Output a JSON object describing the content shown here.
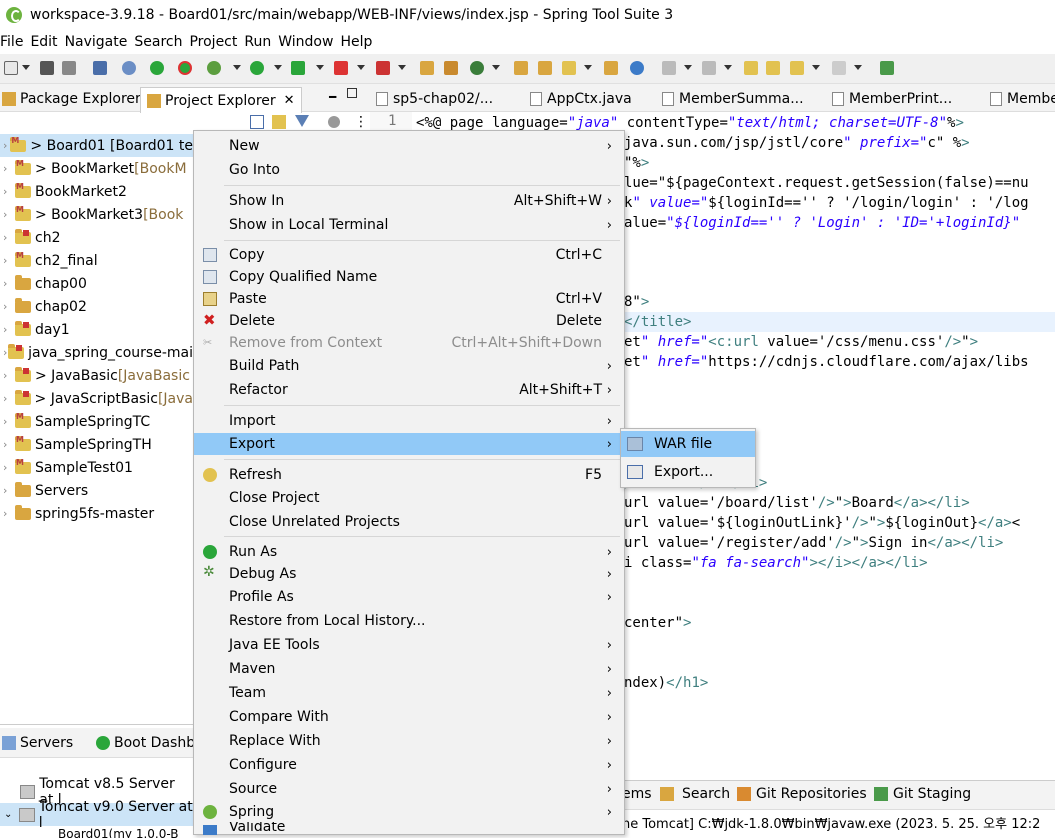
{
  "window": {
    "title": "workspace-3.9.18 - Board01/src/main/webapp/WEB-INF/views/index.jsp - Spring Tool Suite 3"
  },
  "menubar": [
    "File",
    "Edit",
    "Navigate",
    "Search",
    "Project",
    "Run",
    "Window",
    "Help"
  ],
  "left_tabs": {
    "package_explorer": "Package Explorer",
    "project_explorer": "Project Explorer"
  },
  "tree": [
    {
      "label": "> Board01 [Board01 te",
      "deco": "",
      "type": "maven",
      "expand": true,
      "selected": true
    },
    {
      "label": "> BookMarket ",
      "deco": "[BookM",
      "type": "maven",
      "expand": true
    },
    {
      "label": "BookMarket2",
      "deco": "",
      "type": "maven",
      "expand": true
    },
    {
      "label": "> BookMarket3 ",
      "deco": "[Book",
      "type": "maven",
      "expand": true
    },
    {
      "label": "ch2",
      "deco": "",
      "type": "java",
      "expand": true
    },
    {
      "label": "ch2_final",
      "deco": "",
      "type": "maven",
      "expand": true
    },
    {
      "label": "chap00",
      "deco": "",
      "type": "folder",
      "expand": true
    },
    {
      "label": "chap02",
      "deco": "",
      "type": "folder",
      "expand": true
    },
    {
      "label": "day1",
      "deco": "",
      "type": "java",
      "expand": true
    },
    {
      "label": "java_spring_course-mai",
      "deco": "",
      "type": "java",
      "expand": true
    },
    {
      "label": "> JavaBasic ",
      "deco": "[JavaBasic",
      "type": "java",
      "expand": true
    },
    {
      "label": "> JavaScriptBasic ",
      "deco": "[Java",
      "type": "java",
      "expand": true
    },
    {
      "label": "SampleSpringTC",
      "deco": "",
      "type": "maven",
      "expand": true
    },
    {
      "label": "SampleSpringTH",
      "deco": "",
      "type": "maven",
      "expand": true
    },
    {
      "label": "SampleTest01",
      "deco": "",
      "type": "maven",
      "expand": true
    },
    {
      "label": "Servers",
      "deco": "",
      "type": "folder",
      "expand": true
    },
    {
      "label": "spring5fs-master",
      "deco": "",
      "type": "folder",
      "expand": true
    }
  ],
  "bottom_tabs": {
    "servers": "Servers",
    "boot": "Boot Dashb"
  },
  "servers": [
    "Tomcat v8.5 Server at l",
    "Tomcat v9.0 Server at l",
    "Board01(my 1.0.0-B"
  ],
  "editor_tabs": [
    "sp5-chap02/...",
    "AppCtx.java",
    "MemberSumma...",
    "MemberPrint...",
    "Membe"
  ],
  "code_lines": [
    {
      "n": "1",
      "t": "<%@ page language=\"java\" contentType=\"text/html; charset=UTF-8\"%>"
    },
    {
      "t": "java.sun.com/jsp/jstl/core\" prefix=\"c\" %>"
    },
    {
      "t": "\"%>"
    },
    {
      "t": "lue=\"${pageContext.request.getSession(false)==nu"
    },
    {
      "t": "k\" value=\"${loginId=='' ? '/login/login' : '/log"
    },
    {
      "t": "alue=\"${loginId=='' ? 'Login' : 'ID='+loginId}\""
    },
    {
      "t": "8\">"
    },
    {
      "t": "</title>"
    },
    {
      "t": "et\" href=\"<c:url value='/css/menu.css'/>\">"
    },
    {
      "t": "et\" href=\"https://cdnjs.cloudflare.com/ajax/libs"
    },
    {
      "t": "i>"
    },
    {
      "t": "/>\">Home</a></li>"
    },
    {
      "t": "url value='/board/list'/>\">Board</a></li>"
    },
    {
      "t": "url value='${loginOutLink}'/>\">${loginOut}</a><"
    },
    {
      "t": "url value='/register/add'/>\">Sign in</a></li>"
    },
    {
      "t": "i class=\"fa fa-search\"></i></a></li>"
    },
    {
      "t": "center\">"
    },
    {
      "t": "ndex)</h1>"
    }
  ],
  "bottom_right_tabs": {
    "items": "ems",
    "search": "Search",
    "git_repos": "Git Repositories",
    "git_staging": "Git Staging"
  },
  "console_line": "he Tomcat] C:₩jdk-1.8.0₩bin₩javaw.exe  (2023. 5. 25. 오후 12:2",
  "context_menu": {
    "new": "New",
    "go_into": "Go Into",
    "show_in": "Show In",
    "show_in_acc": "Alt+Shift+W",
    "show_terminal": "Show in Local Terminal",
    "copy": "Copy",
    "copy_acc": "Ctrl+C",
    "copy_qualified": "Copy Qualified Name",
    "paste": "Paste",
    "paste_acc": "Ctrl+V",
    "delete": "Delete",
    "delete_acc": "Delete",
    "remove_ctx": "Remove from Context",
    "remove_ctx_acc": "Ctrl+Alt+Shift+Down",
    "build_path": "Build Path",
    "refactor": "Refactor",
    "refactor_acc": "Alt+Shift+T",
    "import": "Import",
    "export": "Export",
    "refresh": "Refresh",
    "refresh_acc": "F5",
    "close_project": "Close Project",
    "close_unrelated": "Close Unrelated Projects",
    "run_as": "Run As",
    "debug_as": "Debug As",
    "profile_as": "Profile As",
    "restore_history": "Restore from Local History...",
    "javaee_tools": "Java EE Tools",
    "maven": "Maven",
    "team": "Team",
    "compare_with": "Compare With",
    "replace_with": "Replace With",
    "configure": "Configure",
    "source": "Source",
    "spring": "Spring",
    "validate": "Validate"
  },
  "submenu": {
    "war_file": "WAR file",
    "export_dots": "Export..."
  }
}
